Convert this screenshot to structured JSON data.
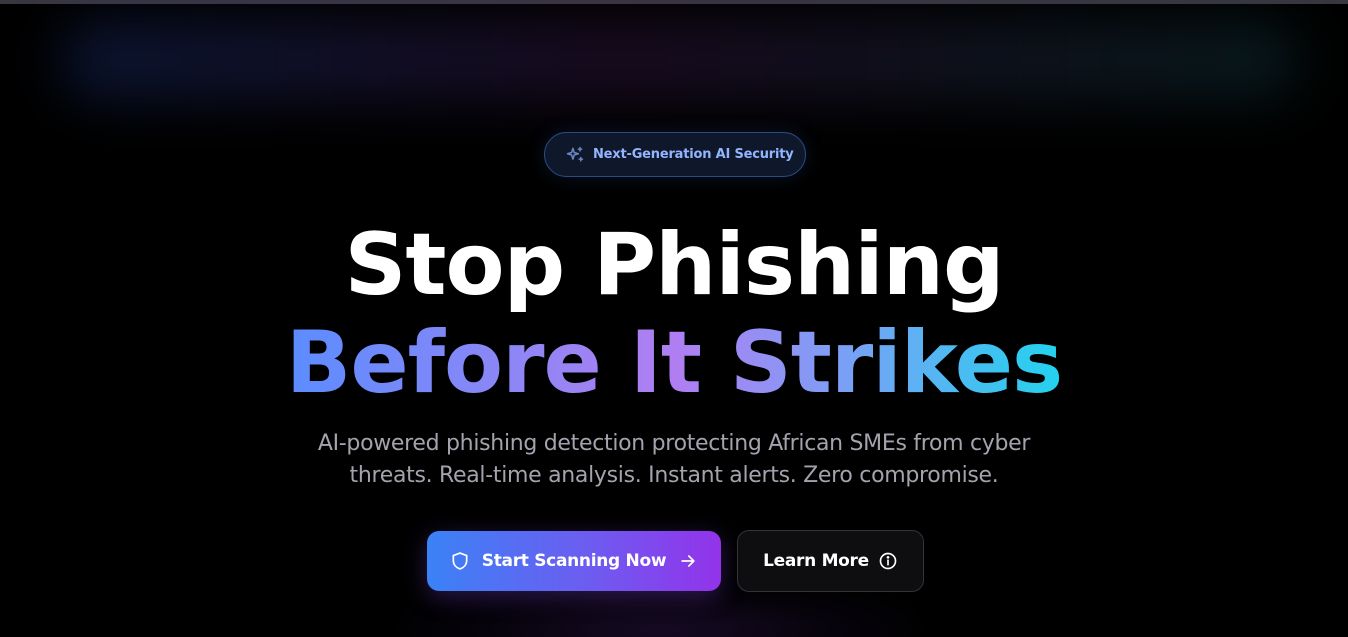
{
  "badge": {
    "icon": "sparkles-icon",
    "text": "Next-Generation AI Security",
    "dot_color": "#4a5a7a"
  },
  "hero": {
    "headline_line1": "Stop Phishing",
    "headline_line2": "Before It Strikes",
    "subtitle_line1": "AI-powered phishing detection protecting African SMEs from cyber",
    "subtitle_line2": "threats. Real-time analysis. Instant alerts. Zero compromise."
  },
  "actions": {
    "primary": {
      "label": "Start Scanning Now",
      "leading_icon": "shield-icon",
      "trailing_icon": "arrow-right-icon"
    },
    "secondary": {
      "label": "Learn More",
      "trailing_icon": "info-icon"
    }
  },
  "colors": {
    "background": "#000000",
    "badge_text": "#93b4ff",
    "gradient_start": "#5b8cff",
    "gradient_mid": "#b07ef2",
    "gradient_end": "#22d3ee",
    "primary_button_start": "#3b82f6",
    "primary_button_end": "#9333ea",
    "subtitle_text": "#a3a3ad"
  }
}
